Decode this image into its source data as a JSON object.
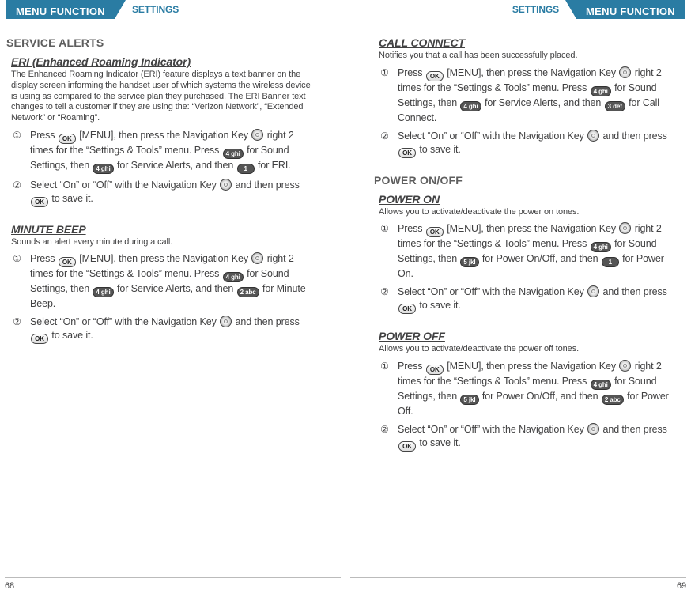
{
  "header": {
    "menu_label": "MENU FUNCTION",
    "settings_label": "SETTINGS"
  },
  "pages": {
    "left_num": "68",
    "right_num": "69"
  },
  "keys": {
    "ok": "OK",
    "k4": "4 ghi",
    "k1": "1",
    "k2": "2 abc",
    "k3": "3 def",
    "k5": "5 jkl"
  },
  "left": {
    "section": "SERVICE ALERTS",
    "eri": {
      "title": "ERI (Enhanced Roaming Indicator)",
      "desc": "The Enhanced Roaming Indicator (ERI) feature displays a text banner on the display screen informing the handset user of which systems the wireless device is using as compared to the service plan they purchased. The ERI Banner text changes to tell a customer if they are using the: “Verizon Network”, “Extended Network” or “Roaming”.",
      "s1a": "Press ",
      "s1b": " [MENU], then press the Navigation Key ",
      "s1c": " right 2 times for the “Settings & Tools” menu. Press ",
      "s1d": " for Sound Settings, then ",
      "s1e": " for Service Alerts, and then ",
      "s1f": " for ERI.",
      "s2a": "Select “On” or “Off” with the Navigation Key ",
      "s2b": " and then press ",
      "s2c": " to save it."
    },
    "minute": {
      "title": "MINUTE BEEP",
      "desc": "Sounds an alert every minute during a call.",
      "s1a": "Press ",
      "s1b": " [MENU], then press the Navigation Key ",
      "s1c": " right 2 times for the “Settings & Tools” menu. Press ",
      "s1d": " for Sound Settings, then ",
      "s1e": " for Service Alerts, and then ",
      "s1f": " for Minute Beep.",
      "s2a": "Select “On” or “Off” with the Navigation Key ",
      "s2b": " and then press ",
      "s2c": " to save it."
    }
  },
  "right": {
    "call": {
      "title": "CALL CONNECT",
      "desc": "Notifies you that a call has been successfully placed.",
      "s1a": "Press ",
      "s1b": " [MENU], then press the Navigation Key ",
      "s1c": " right 2 times for the “Settings & Tools” menu. Press ",
      "s1d": " for Sound Settings, then ",
      "s1e": " for Service Alerts, and then ",
      "s1f": " for Call Connect.",
      "s2a": "Select “On” or “Off” with the Navigation Key ",
      "s2b": " and then press ",
      "s2c": " to save it."
    },
    "section": "POWER ON/OFF",
    "pon": {
      "title": "POWER ON",
      "desc": "Allows you to activate/deactivate the power on tones.",
      "s1a": "Press ",
      "s1b": " [MENU], then press the Navigation Key ",
      "s1c": " right 2 times for the “Settings & Tools” menu. Press ",
      "s1d": " for Sound Settings, then ",
      "s1e": " for Power On/Off, and then ",
      "s1f": " for Power On.",
      "s2a": "Select “On” or “Off” with the Navigation Key ",
      "s2b": " and then press ",
      "s2c": " to save it."
    },
    "poff": {
      "title": "POWER OFF",
      "desc": "Allows you to activate/deactivate the power off tones.",
      "s1a": "Press ",
      "s1b": " [MENU], then press the Navigation Key ",
      "s1c": " right 2 times for the “Settings & Tools” menu. Press ",
      "s1d": " for Sound Settings, then ",
      "s1e": " for Power On/Off, and then ",
      "s1f": " for Power Off.",
      "s2a": "Select “On” or “Off” with the Navigation Key ",
      "s2b": " and then press ",
      "s2c": " to save it."
    }
  }
}
